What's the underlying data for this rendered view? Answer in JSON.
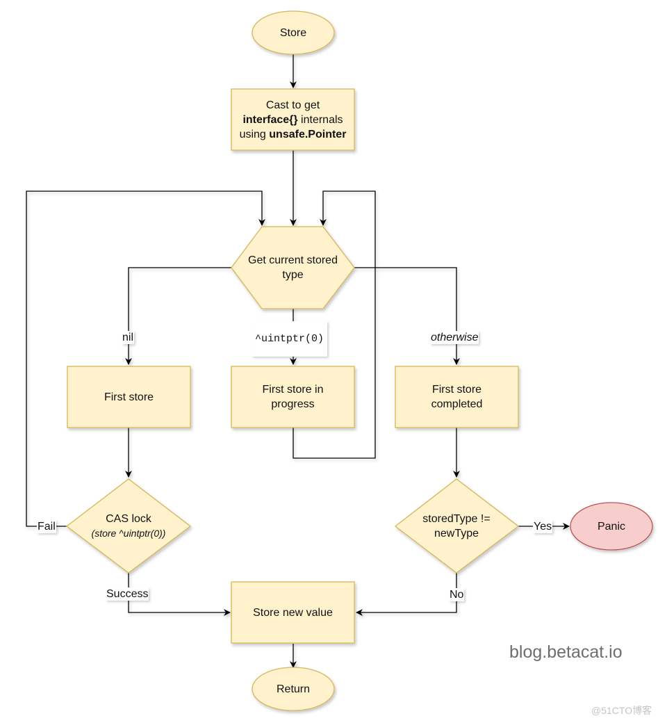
{
  "diagram": {
    "colors": {
      "node_fill": "#fff2cc",
      "node_stroke": "#d6b656",
      "panic_fill": "#f8cecc",
      "panic_stroke": "#b85450",
      "edge": "#000000"
    },
    "nodes": {
      "start": {
        "label": "Store",
        "shape": "ellipse"
      },
      "cast": {
        "line1": "Cast to get",
        "line2_bold": "interface{}",
        "line2_rest": " internals",
        "line3_pre": "using ",
        "line3_bold": "unsafe.Pointer",
        "shape": "rectangle"
      },
      "get_type": {
        "label": "Get current stored type",
        "shape": "hexagon"
      },
      "first_store": {
        "label": "First store",
        "shape": "rectangle"
      },
      "in_progress": {
        "label": "First store in progress",
        "shape": "rectangle"
      },
      "completed": {
        "label": "First store completed",
        "shape": "rectangle"
      },
      "cas": {
        "line1": "CAS lock",
        "line2": "(store ^uintptr(0))",
        "shape": "diamond"
      },
      "type_check": {
        "label": "storedType != newType",
        "shape": "diamond"
      },
      "panic": {
        "label": "Panic",
        "shape": "ellipse"
      },
      "store_value": {
        "label": "Store new value",
        "shape": "rectangle"
      },
      "return": {
        "label": "Return",
        "shape": "ellipse"
      }
    },
    "edge_labels": {
      "nil": "nil",
      "uintptr": "^uintptr(0)",
      "otherwise": "otherwise",
      "fail": "Fail",
      "success": "Success",
      "yes": "Yes",
      "no": "No"
    },
    "edges": [
      {
        "from": "start",
        "to": "cast"
      },
      {
        "from": "cast",
        "to": "get_type"
      },
      {
        "from": "get_type",
        "to": "first_store",
        "label": "nil"
      },
      {
        "from": "get_type",
        "to": "in_progress",
        "label": "^uintptr(0)"
      },
      {
        "from": "get_type",
        "to": "completed",
        "label": "otherwise"
      },
      {
        "from": "in_progress",
        "to": "get_type"
      },
      {
        "from": "first_store",
        "to": "cas"
      },
      {
        "from": "cas",
        "to": "get_type",
        "label": "Fail"
      },
      {
        "from": "cas",
        "to": "store_value",
        "label": "Success"
      },
      {
        "from": "completed",
        "to": "type_check"
      },
      {
        "from": "type_check",
        "to": "panic",
        "label": "Yes"
      },
      {
        "from": "type_check",
        "to": "store_value",
        "label": "No"
      },
      {
        "from": "store_value",
        "to": "return"
      }
    ]
  },
  "watermarks": {
    "blog": "blog.betacat.io",
    "site": "@51CTO博客"
  }
}
